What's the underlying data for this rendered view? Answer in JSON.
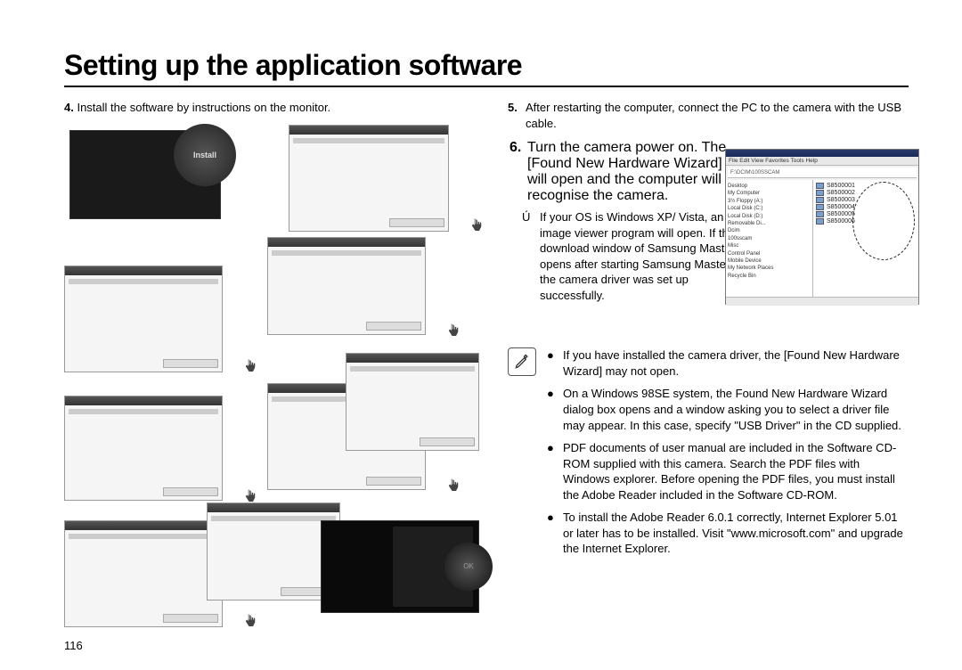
{
  "title": "Setting up the application software",
  "page_number": "116",
  "left": {
    "step4_num": "4.",
    "step4_text": "Install the software by instructions on the monitor.",
    "install_label": "Install"
  },
  "right": {
    "step5_num": "5.",
    "step5_text": "After restarting the computer, connect the PC to the camera with the USB cable.",
    "step6_num": "6.",
    "step6_text": "Turn the camera power on. The [Found New Hardware Wizard] will open and the computer will recognise the camera.",
    "asterisk_sym": "Ú",
    "asterisk_text": "If your OS is Windows XP/ Vista, an image viewer program will open. If the download window of Samsung Master opens after starting Samsung Master, the camera driver was set up successfully.",
    "explorer": {
      "menu": "File  Edit  View  Favorites  Tools  Help",
      "address": "F:\\DCIM\\100SSCAM",
      "tree": [
        "Desktop",
        "  My Computer",
        "    3½ Floppy (A:)",
        "    Local Disk (C:)",
        "    Local Disk (D:)",
        "    Removable Di...",
        "      Dcim",
        "        100sscam",
        "      Misc",
        "    Control Panel",
        "    Mobile Device",
        "    My Network Places",
        "    Recycle Bin"
      ],
      "files": [
        "S8500001",
        "S8500002",
        "S8500003",
        "S8500004",
        "S8500005",
        "S8500006"
      ]
    },
    "notes": [
      "If you have installed the camera driver, the [Found New Hardware Wizard] may not open.",
      "On a Windows 98SE system, the Found New Hardware Wizard dialog box opens and a window asking you to select a driver file may appear. In this case, specify \"USB Driver\" in the CD supplied.",
      "PDF documents of user manual are included in the Software CD-ROM supplied with this camera. Search the PDF files with Windows explorer. Before opening the PDF files, you must install the Adobe Reader included in the Software CD-ROM.",
      "To install the Adobe Reader 6.0.1 correctly, Internet Explorer 5.01 or later has to be installed. Visit \"www.microsoft.com\" and upgrade the Internet Explorer."
    ]
  }
}
